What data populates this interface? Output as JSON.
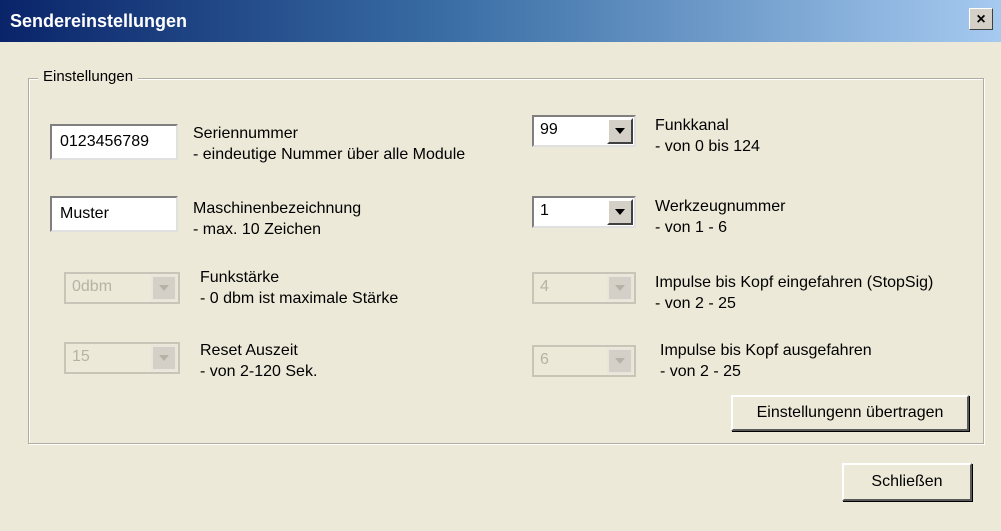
{
  "window": {
    "title": "Sendereinstellungen",
    "close_label": "×"
  },
  "group": {
    "title": "Einstellungen"
  },
  "left": {
    "serial": {
      "value": "0123456789",
      "label": "Seriennummer",
      "hint": "- eindeutige Nummer über alle Module"
    },
    "machine": {
      "value": "Muster",
      "label": "Maschinenbezeichnung",
      "hint": "- max. 10 Zeichen"
    },
    "power": {
      "value": "0dbm",
      "label": "Funkstärke",
      "hint": "- 0 dbm ist maximale Stärke"
    },
    "reset": {
      "value": "15",
      "label": "Reset Auszeit",
      "hint": "- von 2-120 Sek."
    }
  },
  "right": {
    "channel": {
      "value": "99",
      "label": "Funkkanal",
      "hint": "- von 0 bis 124"
    },
    "tool": {
      "value": "1",
      "label": "Werkzeugnummer",
      "hint": "- von 1 - 6"
    },
    "pulses_in": {
      "value": "4",
      "label": "Impulse bis Kopf eingefahren (StopSig)",
      "hint": "- von  2 - 25"
    },
    "pulses_out": {
      "value": "6",
      "label": "Impulse bis Kopf ausgefahren",
      "hint": "- von 2 - 25"
    }
  },
  "buttons": {
    "transfer": "Einstellungenn übertragen",
    "close": "Schließen"
  }
}
